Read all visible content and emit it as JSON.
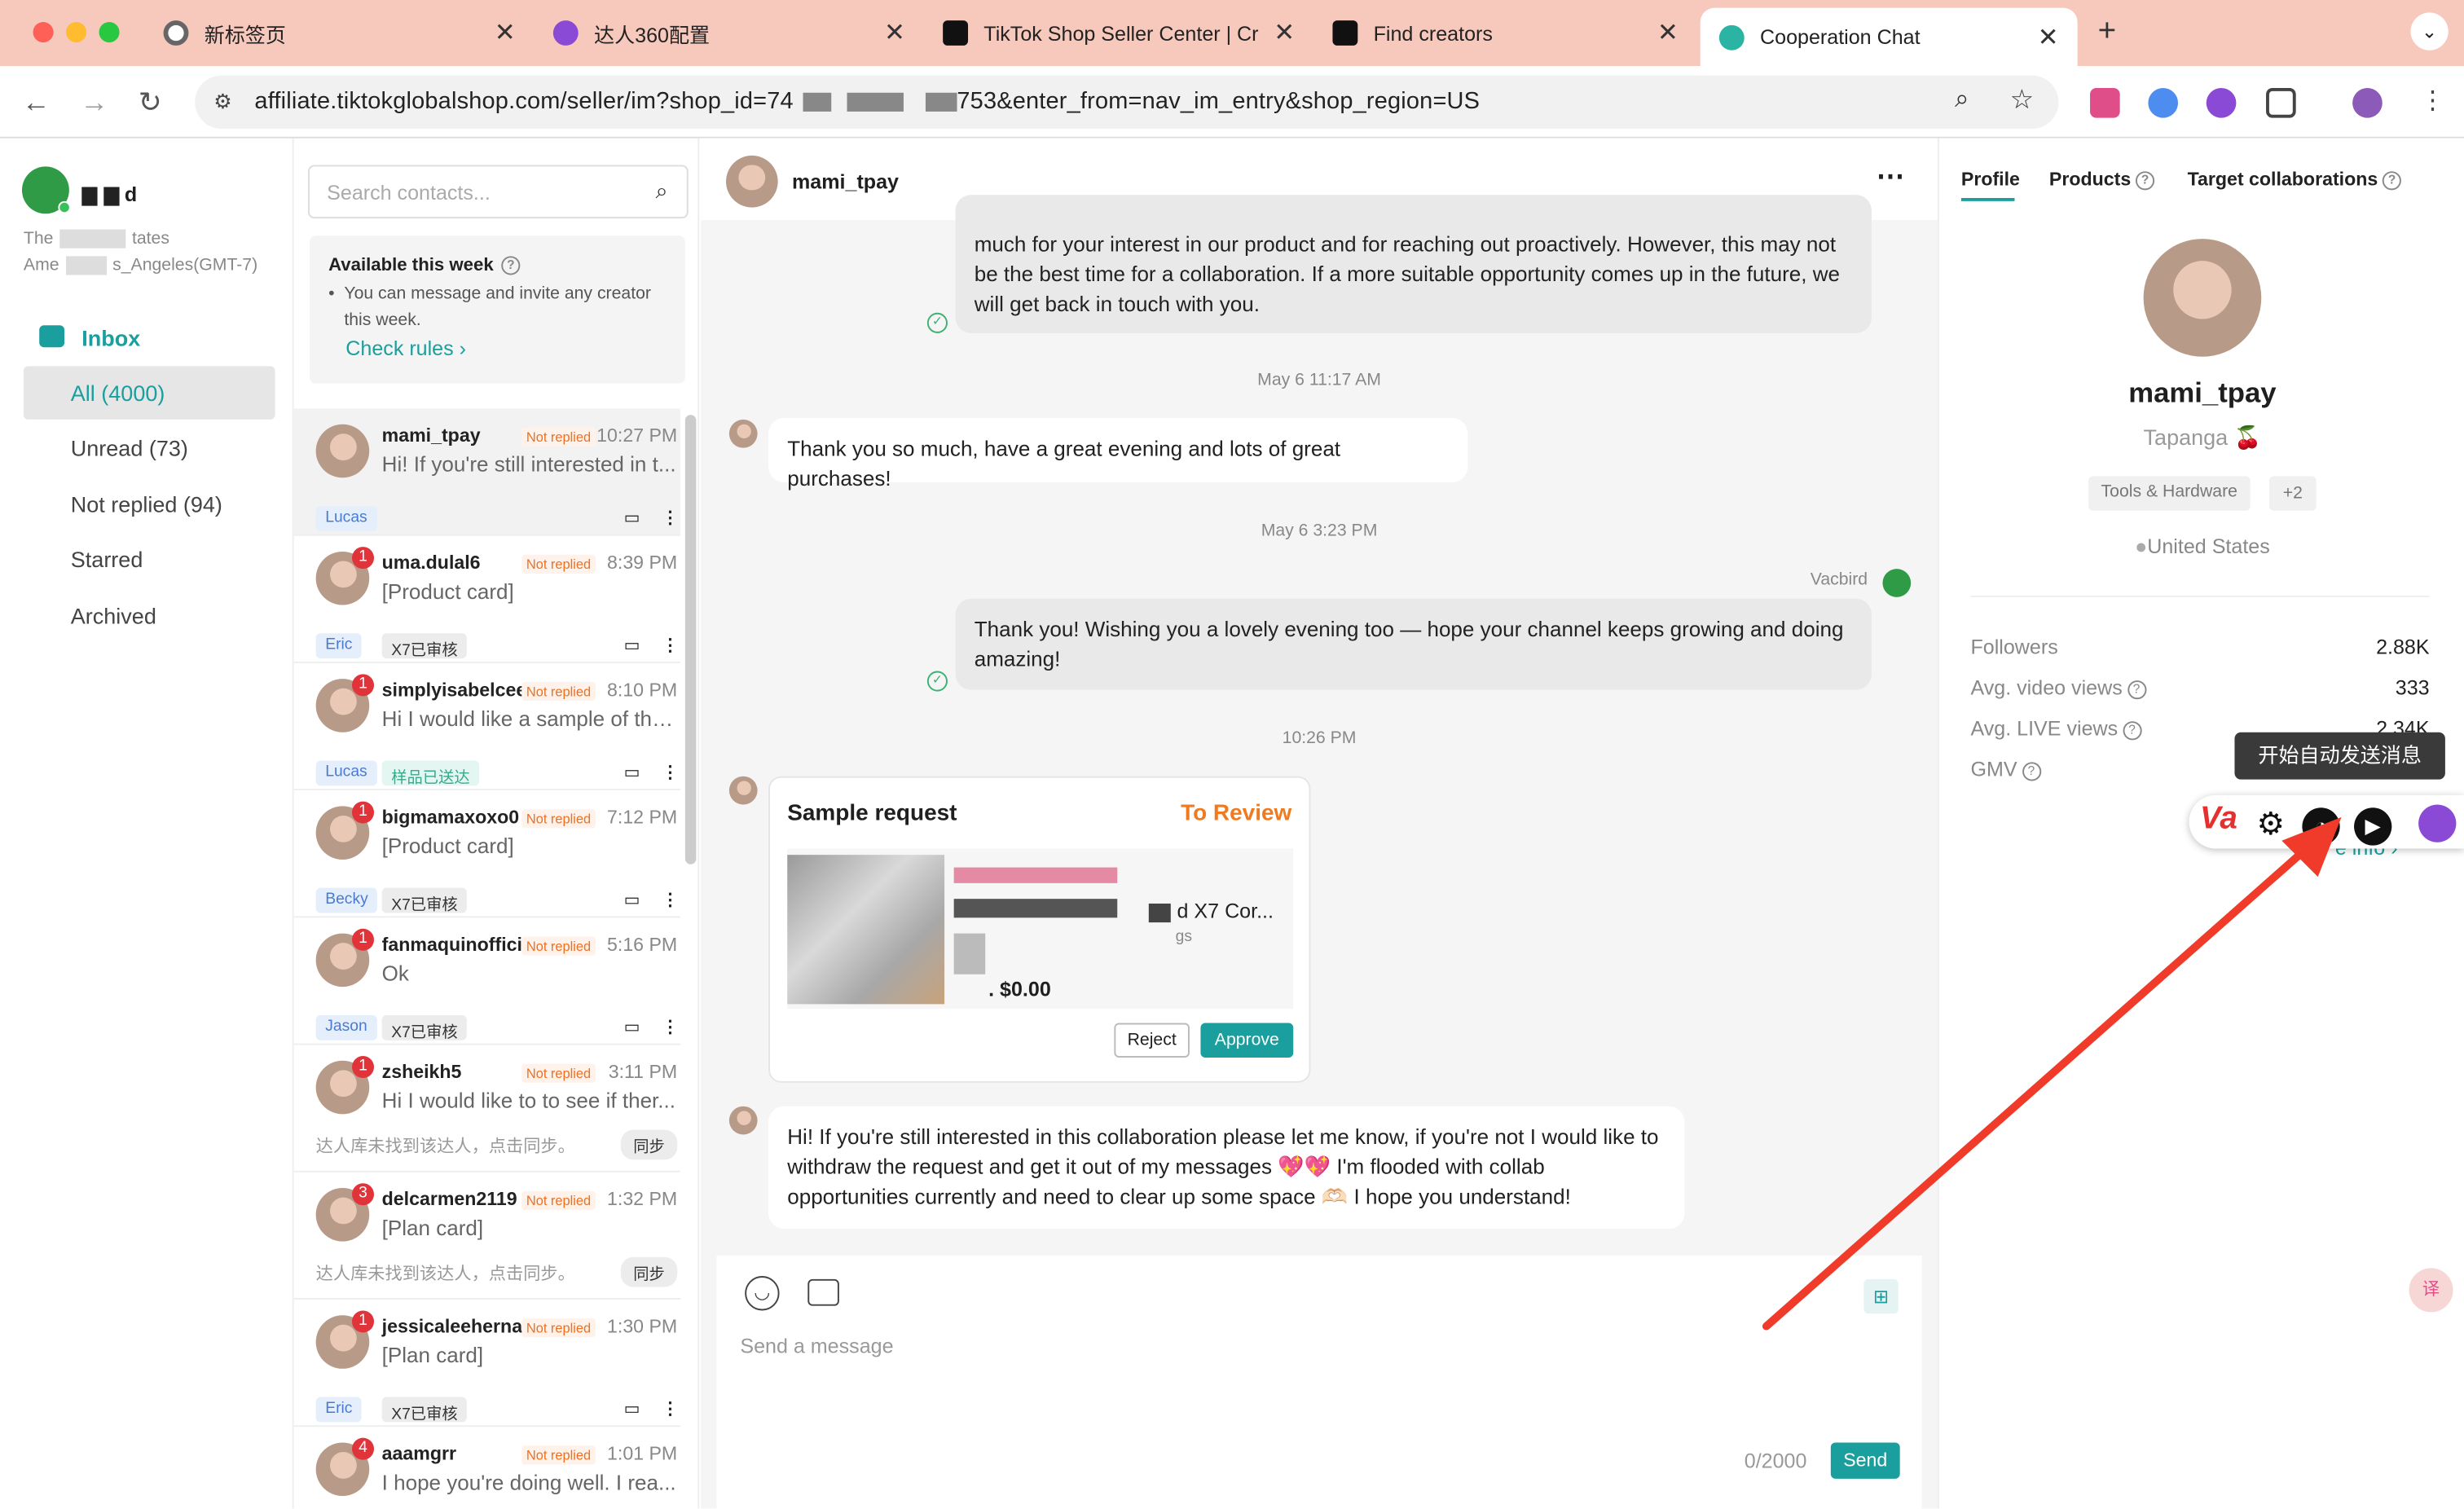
{
  "browser": {
    "tabs": [
      {
        "title": "新标签页"
      },
      {
        "title": "达人360配置"
      },
      {
        "title": "TikTok Shop Seller Center | Cr"
      },
      {
        "title": "Find creators"
      },
      {
        "title": "Cooperation Chat"
      }
    ],
    "url_part1": "affiliate.tiktokglobalshop.com/seller/im?shop_id=74",
    "url_part2": "753&enter_from=nav_im_entry&shop_region=US"
  },
  "sidebar": {
    "shop_name": "d",
    "region_line1": "The",
    "region_line1b": "tates",
    "region_line2": "Ame",
    "region_line2b": "s_Angeles(GMT-7)",
    "inbox_label": "Inbox",
    "items": [
      {
        "label": "All (4000)"
      },
      {
        "label": "Unread (73)"
      },
      {
        "label": "Not replied (94)"
      },
      {
        "label": "Starred"
      },
      {
        "label": "Archived"
      }
    ]
  },
  "contacts": {
    "search_placeholder": "Search contacts...",
    "available_title": "Available this week",
    "available_text": "You can message and invite any creator this week.",
    "check_rules": "Check rules",
    "not_replied_label": "Not replied",
    "list": [
      {
        "name": "mami_tpay",
        "time": "10:27 PM",
        "msg": "Hi! If you're still interested in t...",
        "tags": [
          "Lucas"
        ],
        "badge": ""
      },
      {
        "name": "uma.dulal6",
        "time": "8:39 PM",
        "msg": "[Product card]",
        "tags": [
          "Eric",
          "X7已审核"
        ],
        "badge": "1"
      },
      {
        "name": "simplyisabelcee",
        "time": "8:10 PM",
        "msg": "Hi I would like a sample of the...",
        "tags": [
          "Lucas",
          "样品已送达"
        ],
        "badge": "1"
      },
      {
        "name": "bigmamaxoxo0",
        "time": "7:12 PM",
        "msg": "[Product card]",
        "tags": [
          "Becky",
          "X7已审核"
        ],
        "badge": "1"
      },
      {
        "name": "fanmaquinofficial",
        "time": "5:16 PM",
        "msg": "Ok",
        "tags": [
          "Jason",
          "X7已审核"
        ],
        "badge": "1"
      },
      {
        "name": "zsheikh5",
        "time": "3:11 PM",
        "msg": "Hi I would like to to see if ther...",
        "note": "达人库未找到该达人，点击同步。",
        "sync": "同步",
        "badge": "1"
      },
      {
        "name": "delcarmen2119",
        "time": "1:32 PM",
        "msg": "[Plan card]",
        "note": "达人库未找到该达人，点击同步。",
        "sync": "同步",
        "badge": "3"
      },
      {
        "name": "jessicaleeherna...",
        "time": "1:30 PM",
        "msg": "[Plan card]",
        "tags": [
          "Eric",
          "X7已审核"
        ],
        "badge": "1"
      },
      {
        "name": "aaamgrr",
        "time": "1:01 PM",
        "msg": "I hope you're doing well. I rea...",
        "badge": "4"
      }
    ]
  },
  "chat": {
    "header_name": "mami_tpay",
    "msg1": "much for your interest in our product and for reaching out proactively. However, this may not be the best time for a collaboration. If a more suitable opportunity comes up in the future, we will get back in touch with you.",
    "ts1": "May 6 11:17 AM",
    "msg2": "Thank you so much, have a great evening and lots of great purchases!",
    "ts2": "May 6 3:23 PM",
    "sender": "Vacbird",
    "msg3": "Thank you! Wishing you a lovely evening too — hope your channel keeps growing and doing amazing!",
    "ts3": "10:26 PM",
    "sample_title": "Sample request",
    "sample_status": "To Review",
    "product_name": "d X7 Cor...",
    "product_sub": "gs",
    "product_price": ". $0.00",
    "reject": "Reject",
    "approve": "Approve",
    "msg4": "Hi! If you're still interested in this collaboration please let me know, if you're not I would like to withdraw the request and get it out of my messages 💖💖 I'm flooded with collab opportunities currently and need to clear up some space 🫶🏻 I hope you understand!",
    "input_placeholder": "Send a message",
    "char_count": "0/2000",
    "send": "Send"
  },
  "profile": {
    "tabs": [
      {
        "label": "Profile"
      },
      {
        "label": "Products"
      },
      {
        "label": "Target collaborations"
      }
    ],
    "name": "mami_tpay",
    "nickname": "Tapanga",
    "category": "Tools & Hardware",
    "more_cats": "+2",
    "location": "United States",
    "stats": [
      {
        "label": "Followers",
        "value": "2.88K"
      },
      {
        "label": "Avg. video views",
        "value": "333"
      },
      {
        "label": "Avg. LIVE views",
        "value": "2.34K"
      },
      {
        "label": "GMV",
        "value": ""
      }
    ],
    "more_info": "e info"
  },
  "overlay": {
    "tooltip": "开始自动发送消息",
    "va_logo": "Va",
    "arrow_color": "#f03a2a"
  },
  "colors": {
    "accent": "#1a9e9e",
    "tab_bg": "#f7c8bc",
    "orange": "#f07a1f"
  }
}
